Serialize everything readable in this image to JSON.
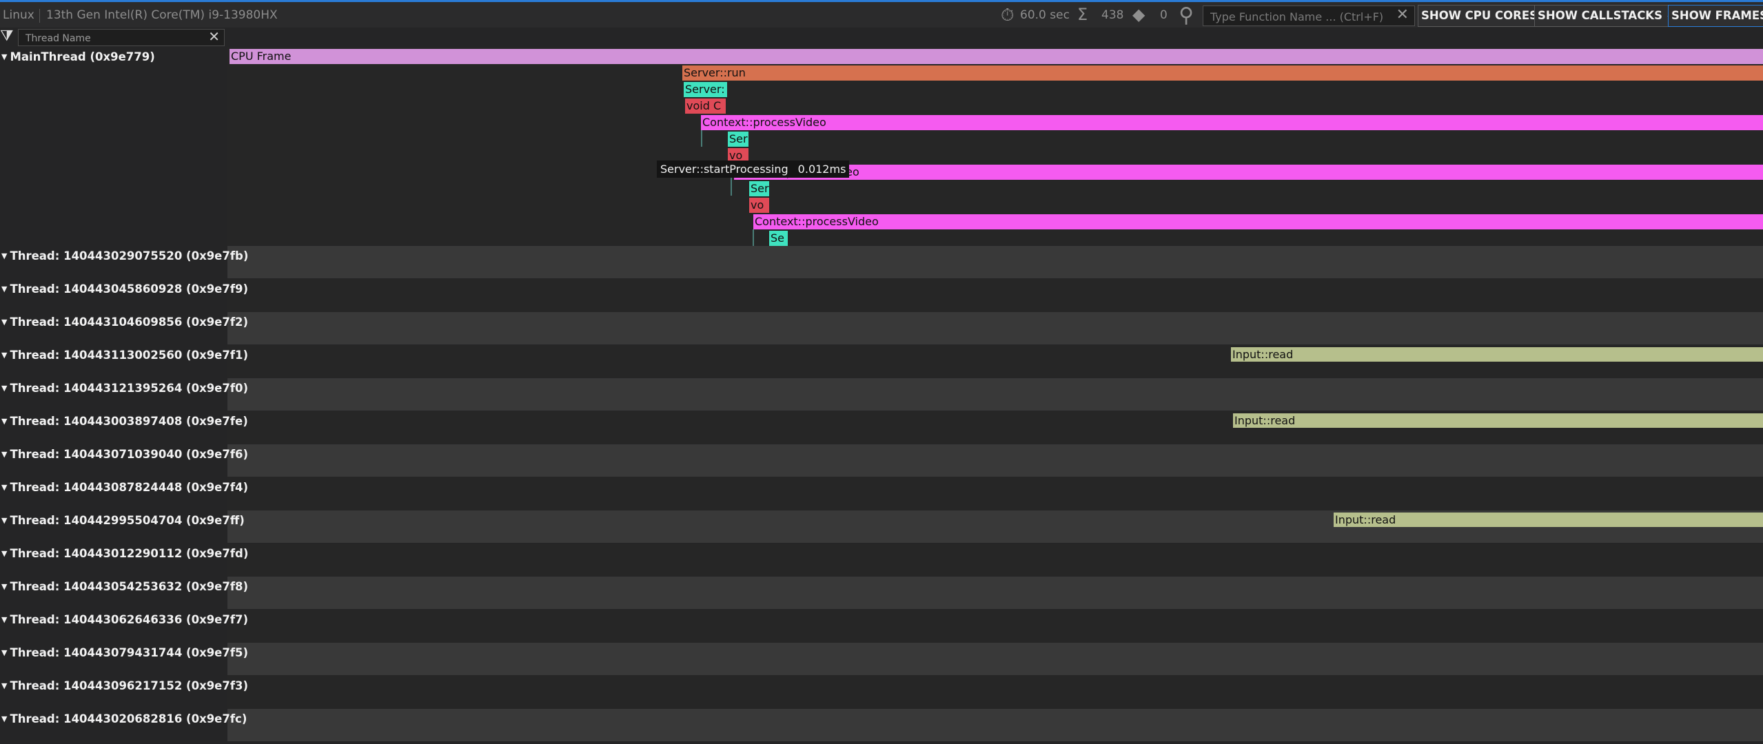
{
  "toolbar": {
    "os": "Linux",
    "cpu": "13th Gen Intel(R) Core(TM) i9-13980HX",
    "duration": "60.0 sec",
    "sum_count": "438",
    "marker_count": "0",
    "search_placeholder": "Type Function Name ... (Ctrl+F)",
    "buttons": {
      "cpu_cores": "SHOW CPU CORES",
      "callstacks": "SHOW CALLSTACKS",
      "frames": "SHOW FRAMES"
    }
  },
  "filter": {
    "placeholder": "Thread Name"
  },
  "main_thread": {
    "label": "MainThread (0x9e779)",
    "events": [
      {
        "name": "CPU Frame",
        "color": "#d192d8"
      },
      {
        "name": "Server::run",
        "color": "#d6714f"
      },
      {
        "name": "Server:",
        "color": "#3fe2bf"
      },
      {
        "name": "void C",
        "color": "#e04a57"
      },
      {
        "name": "Context::processVideo",
        "color": "#f55bf0"
      },
      {
        "name": "Ser",
        "color": "#3fe2bf"
      },
      {
        "name": "vo",
        "color": "#e04a57"
      },
      {
        "name": "Context::processVideo",
        "color": "#f55bf0"
      },
      {
        "name": "Ser",
        "color": "#3fe2bf"
      },
      {
        "name": "vo",
        "color": "#e04a57"
      },
      {
        "name": "Context::processVideo",
        "color": "#f55bf0"
      },
      {
        "name": "Se",
        "color": "#3fe2bf"
      }
    ],
    "tooltip": {
      "name": "Server::startProcessing",
      "duration": "0.012ms"
    }
  },
  "threads": [
    {
      "label": "Thread: 140443029075520 (0x9e7fb)"
    },
    {
      "label": "Thread: 140443045860928 (0x9e7f9)"
    },
    {
      "label": "Thread: 140443104609856 (0x9e7f2)"
    },
    {
      "label": "Thread: 140443113002560 (0x9e7f1)",
      "event": "Input::read"
    },
    {
      "label": "Thread: 140443121395264 (0x9e7f0)"
    },
    {
      "label": "Thread: 140443003897408 (0x9e7fe)",
      "event": "Input::read"
    },
    {
      "label": "Thread: 140443071039040 (0x9e7f6)"
    },
    {
      "label": "Thread: 140443087824448 (0x9e7f4)"
    },
    {
      "label": "Thread: 140442995504704 (0x9e7ff)",
      "event": "Input::read"
    },
    {
      "label": "Thread: 140443012290112 (0x9e7fd)"
    },
    {
      "label": "Thread: 140443054253632 (0x9e7f8)"
    },
    {
      "label": "Thread: 140443062646336 (0x9e7f7)"
    },
    {
      "label": "Thread: 140443079431744 (0x9e7f5)"
    },
    {
      "label": "Thread: 140443096217152 (0x9e7f3)"
    },
    {
      "label": "Thread: 140443020682816 (0x9e7fc)"
    }
  ],
  "colors": {
    "input_read": "#b6bf8c",
    "accent": "#2a7bd6"
  }
}
